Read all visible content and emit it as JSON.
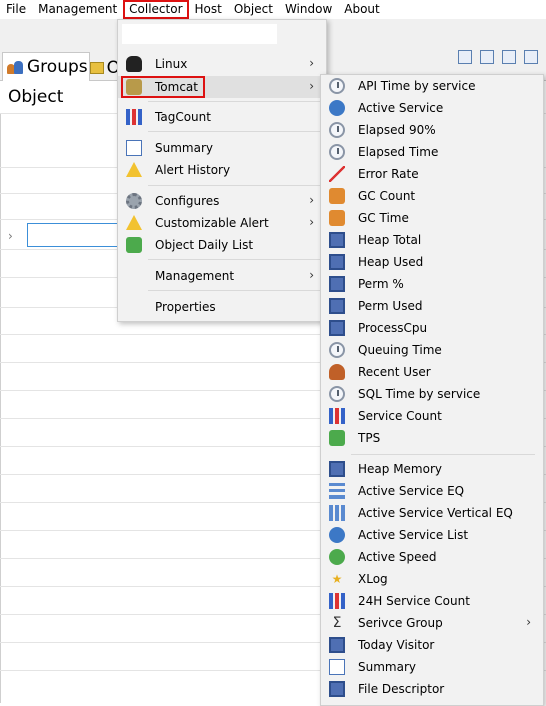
{
  "menubar": {
    "items": [
      "File",
      "Management",
      "Collector",
      "Host",
      "Object",
      "Window",
      "About"
    ]
  },
  "tabs": {
    "groups_label": "Groups",
    "second_label": "O"
  },
  "panel": {
    "title": "Object"
  },
  "collector_menu": {
    "items": [
      {
        "label": "Linux",
        "icon": "penguin-icon",
        "submenu": true
      },
      {
        "label": "Tomcat",
        "icon": "tomcat-icon",
        "submenu": true
      },
      {
        "label": "TagCount",
        "icon": "bar-chart-icon",
        "submenu": false
      },
      {
        "label": "Summary",
        "icon": "summary-icon",
        "submenu": false
      },
      {
        "label": "Alert History",
        "icon": "warning-icon",
        "submenu": false
      },
      {
        "label": "Configures",
        "icon": "gear-icon",
        "submenu": true
      },
      {
        "label": "Customizable Alert",
        "icon": "warning-icon",
        "submenu": true
      },
      {
        "label": "Object Daily List",
        "icon": "daily-list-icon",
        "submenu": false
      },
      {
        "label": "Management",
        "icon": "",
        "submenu": true
      },
      {
        "label": "Properties",
        "icon": "",
        "submenu": false
      }
    ]
  },
  "tomcat_menu": {
    "items": [
      {
        "label": "API Time by service",
        "icon": "clock-icon"
      },
      {
        "label": "Active Service",
        "icon": "fast-forward-icon"
      },
      {
        "label": "Elapsed 90%",
        "icon": "clock-icon"
      },
      {
        "label": "Elapsed Time",
        "icon": "clock-icon"
      },
      {
        "label": "Error Rate",
        "icon": "error-rate-icon"
      },
      {
        "label": "GC Count",
        "icon": "gc-icon"
      },
      {
        "label": "GC Time",
        "icon": "gc-icon"
      },
      {
        "label": "Heap Total",
        "icon": "heap-icon"
      },
      {
        "label": "Heap Used",
        "icon": "heap-icon"
      },
      {
        "label": "Perm %",
        "icon": "heap-icon"
      },
      {
        "label": "Perm Used",
        "icon": "heap-icon"
      },
      {
        "label": "ProcessCpu",
        "icon": "monitor-icon"
      },
      {
        "label": "Queuing Time",
        "icon": "clock-icon"
      },
      {
        "label": "Recent User",
        "icon": "person-icon"
      },
      {
        "label": "SQL Time by service",
        "icon": "clock-icon"
      },
      {
        "label": "Service Count",
        "icon": "service-count-icon"
      },
      {
        "label": "TPS",
        "icon": "tps-icon"
      },
      {
        "label": "Heap Memory",
        "icon": "heap-icon"
      },
      {
        "label": "Active Service EQ",
        "icon": "equalizer-icon"
      },
      {
        "label": "Active Service Vertical EQ",
        "icon": "vertical-equalizer-icon"
      },
      {
        "label": "Active Service List",
        "icon": "service-list-icon"
      },
      {
        "label": "Active Speed",
        "icon": "speed-icon"
      },
      {
        "label": "XLog",
        "icon": "star-icon"
      },
      {
        "label": "24H Service Count",
        "icon": "bar-chart-icon"
      },
      {
        "label": "Serivce Group",
        "icon": "sigma-icon",
        "submenu": true
      },
      {
        "label": "Today Visitor",
        "icon": "monitor-icon"
      },
      {
        "label": "Summary",
        "icon": "summary-icon"
      },
      {
        "label": "File Descriptor",
        "icon": "monitor-icon"
      }
    ]
  }
}
